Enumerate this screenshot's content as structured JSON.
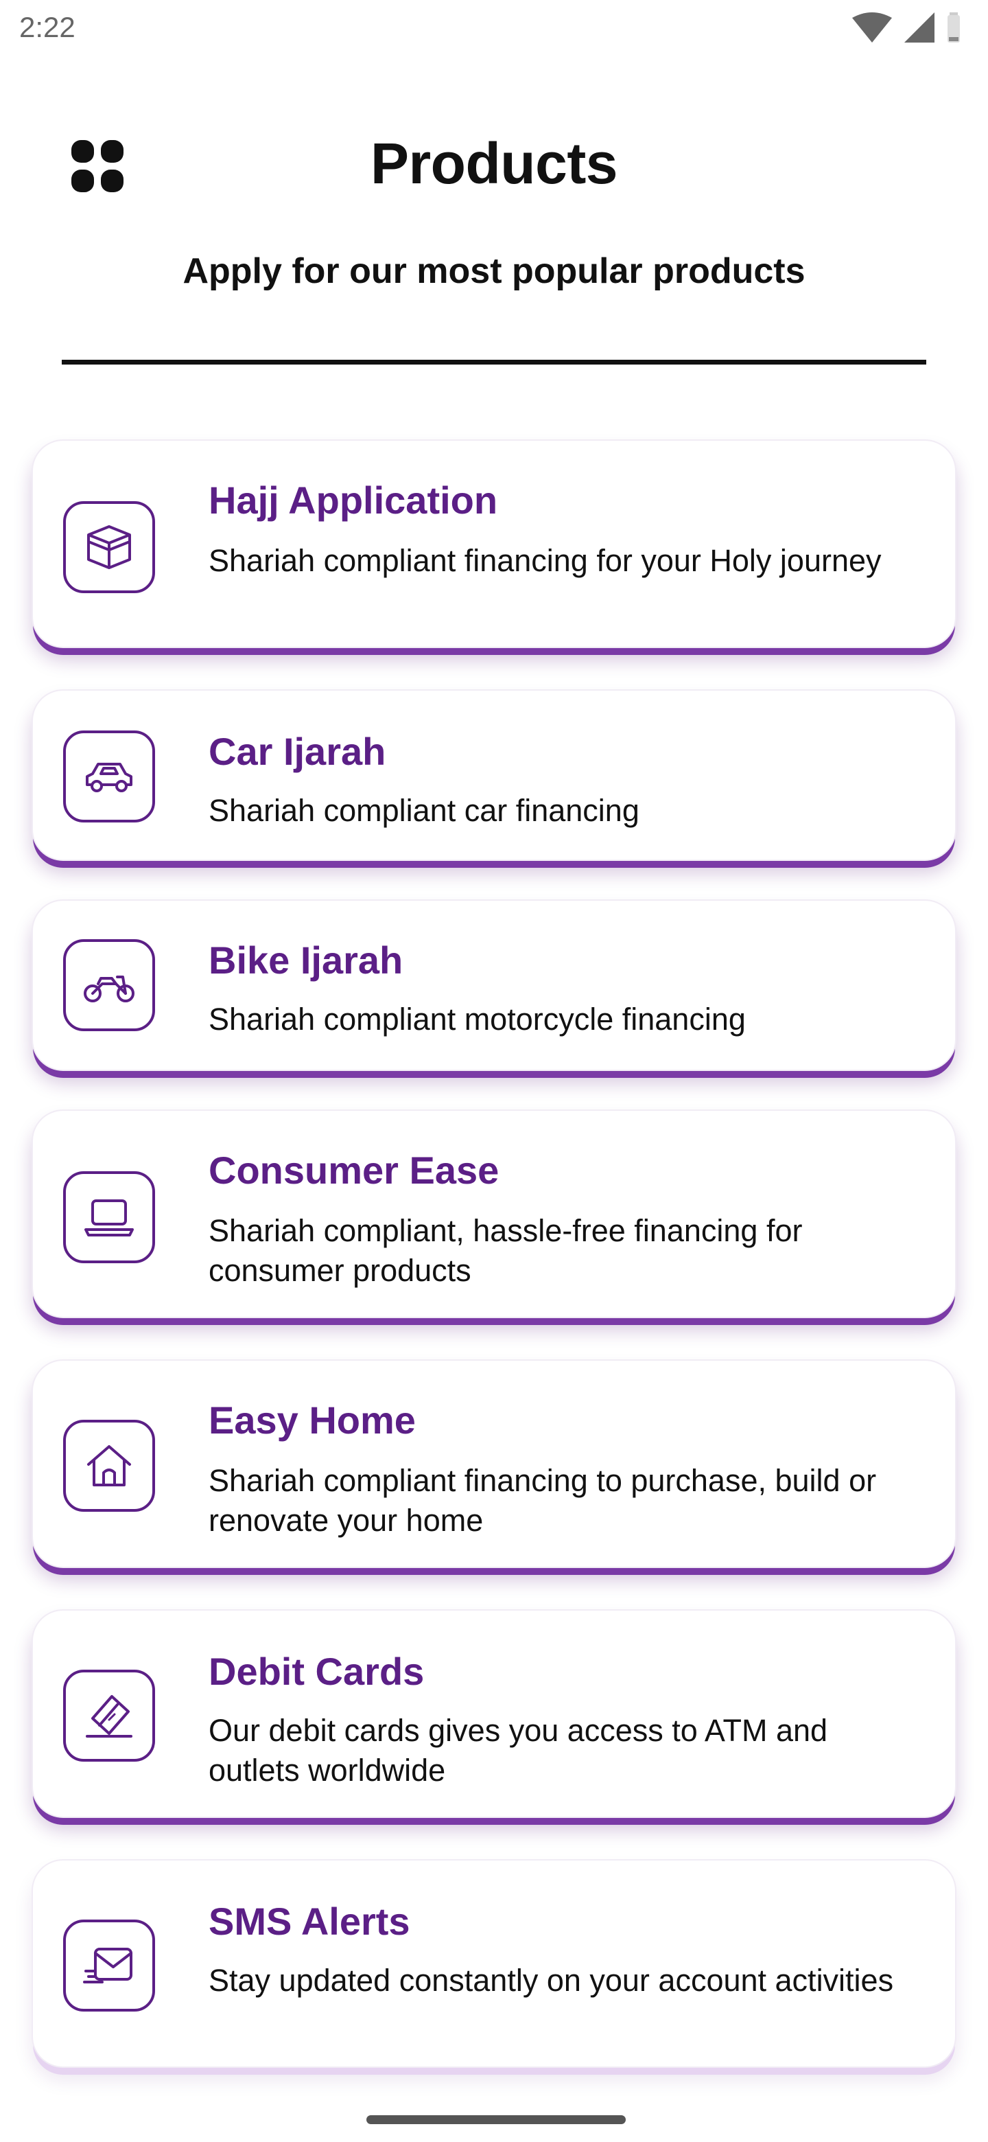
{
  "status_bar": {
    "time": "2:22",
    "icons": [
      "wifi-icon",
      "cellular-signal-icon",
      "battery-icon"
    ]
  },
  "header": {
    "menu_icon": "grid-menu-icon",
    "title": "Products",
    "subtitle": "Apply for our most popular products"
  },
  "colors": {
    "accent": "#5b1f86",
    "card_bottom_accent": "#7a3aa6",
    "text": "#111111",
    "background": "#ffffff"
  },
  "products": [
    {
      "icon": "kaaba-icon",
      "title": "Hajj Application",
      "description": "Shariah compliant financing for your Holy journey"
    },
    {
      "icon": "car-icon",
      "title": "Car Ijarah",
      "description": "Shariah compliant car financing"
    },
    {
      "icon": "motorcycle-icon",
      "title": "Bike Ijarah",
      "description": "Shariah compliant motorcycle financing"
    },
    {
      "icon": "laptop-icon",
      "title": "Consumer Ease",
      "description": "Shariah compliant, hassle-free financing for consumer products"
    },
    {
      "icon": "home-icon",
      "title": "Easy Home",
      "description": "Shariah compliant financing to purchase, build or renovate your home"
    },
    {
      "icon": "debit-card-icon",
      "title": "Debit Cards",
      "description": "Our debit cards gives you access to ATM and outlets worldwide"
    },
    {
      "icon": "sms-envelope-icon",
      "title": "SMS Alerts",
      "description": "Stay updated constantly on your account activities"
    }
  ]
}
